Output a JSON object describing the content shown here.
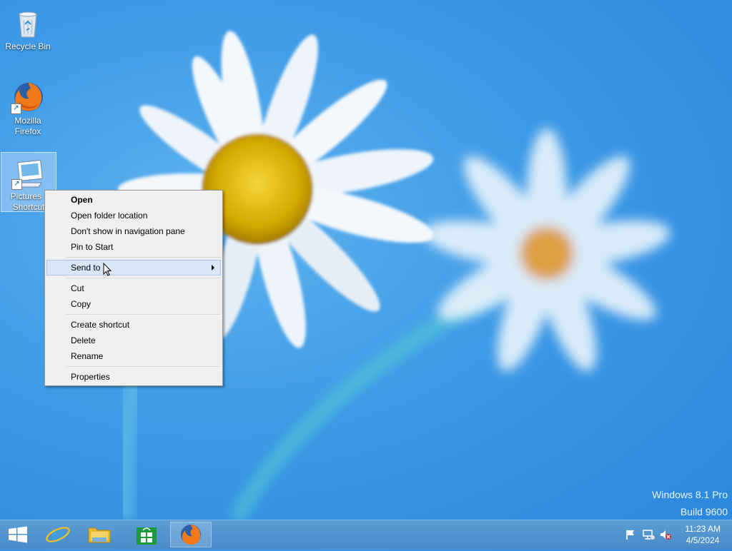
{
  "desktop": {
    "icons": [
      {
        "label": "Recycle Bin"
      },
      {
        "label": "Mozilla Firefox"
      },
      {
        "label": "Pictures - Shortcut"
      }
    ]
  },
  "context_menu": {
    "items": {
      "open": "Open",
      "open_folder_location": "Open folder location",
      "dont_show_nav": "Don't show in navigation pane",
      "pin_to_start": "Pin to Start",
      "send_to": "Send to",
      "cut": "Cut",
      "copy": "Copy",
      "create_shortcut": "Create shortcut",
      "delete": "Delete",
      "rename": "Rename",
      "properties": "Properties"
    }
  },
  "watermark": {
    "edition": "Windows 8.1 Pro",
    "build": "Build 9600"
  },
  "taskbar": {
    "clock_time": "11:23 AM",
    "clock_date": "4/5/2024"
  }
}
